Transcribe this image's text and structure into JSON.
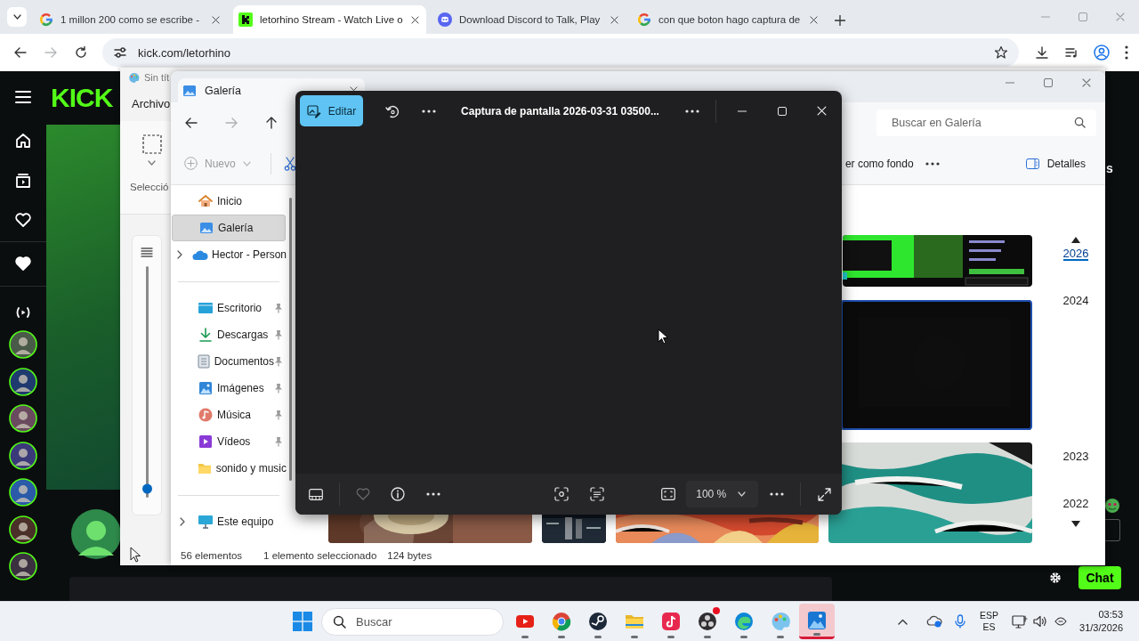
{
  "browser": {
    "tabs": [
      {
        "title": "1 millon 200 como se escribe -",
        "selected": false
      },
      {
        "title": "letorhino Stream - Watch Live o",
        "selected": true
      },
      {
        "title": "Download Discord to Talk, Play",
        "selected": false
      },
      {
        "title": "con que boton hago captura de",
        "selected": false
      }
    ],
    "address": "kick.com/letorhino"
  },
  "kick": {
    "logo": "KICK",
    "chat_fragment": "s",
    "chat_button": "Chat"
  },
  "paint": {
    "title": "Sin tít",
    "menu": "Archivo",
    "group_label": "Selecció",
    "zoom_slider": {
      "level": 0.04
    }
  },
  "explorer": {
    "tab": "Galería",
    "new_button": {
      "label": "Nuevo",
      "disabled": true
    },
    "search_placeholder": "Buscar en Galería",
    "toolbar_label": "er como fondo",
    "details_button": "Detalles",
    "nav_groups": [
      [
        {
          "label": "Inicio",
          "selected": false,
          "expandable": false,
          "pinned": false
        },
        {
          "label": "Galería",
          "selected": true,
          "expandable": false,
          "pinned": false
        },
        {
          "label": "Hector - Person",
          "selected": false,
          "expandable": true,
          "pinned": false
        }
      ],
      [
        {
          "label": "Escritorio",
          "selected": false,
          "expandable": false,
          "pinned": true
        },
        {
          "label": "Descargas",
          "selected": false,
          "expandable": false,
          "pinned": true
        },
        {
          "label": "Documentos",
          "selected": false,
          "expandable": false,
          "pinned": true
        },
        {
          "label": "Imágenes",
          "selected": false,
          "expandable": false,
          "pinned": true
        },
        {
          "label": "Música",
          "selected": false,
          "expandable": false,
          "pinned": true
        },
        {
          "label": "Vídeos",
          "selected": false,
          "expandable": false,
          "pinned": true
        },
        {
          "label": "sonido y music",
          "selected": false,
          "expandable": false,
          "pinned": false
        }
      ],
      [
        {
          "label": "Este equipo",
          "selected": false,
          "expandable": true,
          "pinned": false
        }
      ]
    ],
    "thumbnail_rows": [
      [
        {
          "kind": "picture",
          "selected": false
        }
      ],
      [
        {
          "kind": "picture",
          "selected": true
        }
      ],
      [
        {
          "kind": "picture",
          "selected": false
        },
        {
          "kind": "picture",
          "selected": false
        },
        {
          "kind": "picture",
          "selected": false
        },
        {
          "kind": "picture",
          "selected": false
        }
      ]
    ],
    "timeline": [
      {
        "year": "2026",
        "selected": true
      },
      {
        "year": "2024",
        "selected": false
      },
      {
        "year": "2023",
        "selected": false
      },
      {
        "year": "2022",
        "selected": false
      }
    ],
    "status": [
      "56 elementos",
      "1 elemento seleccionado",
      "124 bytes"
    ]
  },
  "photos": {
    "edit_button": "Editar",
    "title": "Captura de pantalla 2026-03-31 03500...",
    "favorite": false,
    "zoom": "100 %"
  },
  "taskbar": {
    "search_placeholder": "Buscar",
    "apps": [
      {
        "running": true,
        "active": false,
        "badge": false
      },
      {
        "running": true,
        "active": false,
        "badge": false
      },
      {
        "running": true,
        "active": false,
        "badge": false
      },
      {
        "running": true,
        "active": false,
        "badge": false
      },
      {
        "running": true,
        "active": false,
        "badge": false
      },
      {
        "running": true,
        "active": false,
        "badge": true
      },
      {
        "running": true,
        "active": false,
        "badge": false
      },
      {
        "running": true,
        "active": false,
        "badge": false
      },
      {
        "running": true,
        "active": true,
        "badge": false
      }
    ],
    "language": "ESP",
    "layout": "ES",
    "time": "03:53",
    "date": "31/3/2026"
  }
}
